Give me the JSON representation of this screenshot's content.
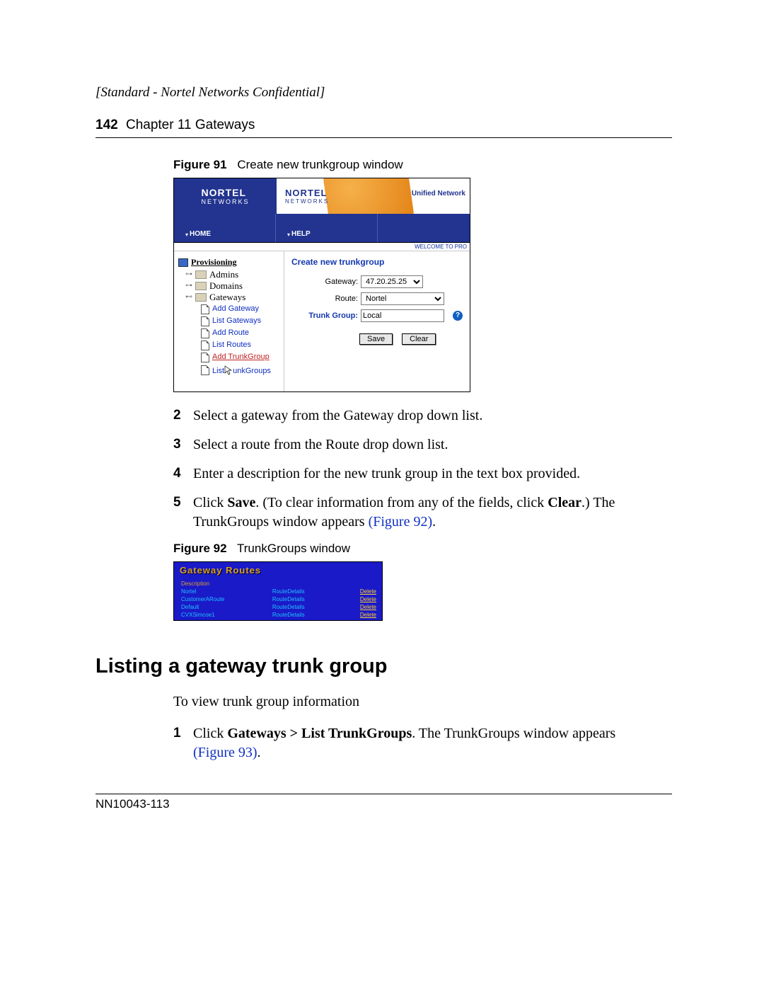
{
  "confidential": "[Standard - Nortel Networks Confidential]",
  "header": {
    "page": "142",
    "chapter": "Chapter 11  Gateways"
  },
  "fig91": {
    "caption_num": "Figure 91",
    "caption_text": "Create new trunkgroup window",
    "brand_big": "NORTEL",
    "brand_small": "NETWORKS",
    "unified": "Unified Network",
    "menu_home": "HOME",
    "menu_help": "HELP",
    "welcome": "WELCOME TO PRO",
    "nav": {
      "root": "Provisioning",
      "admins": "Admins",
      "domains": "Domains",
      "gateways": "Gateways",
      "add_gateway": "Add Gateway",
      "list_gateways": "List Gateways",
      "add_route": "Add Route",
      "list_routes": "List Routes",
      "add_trunkgroup": "Add TrunkGroup",
      "list_trunkgroups": "List TrunkGroups"
    },
    "form": {
      "title": "Create new trunkgroup",
      "gateway_label": "Gateway:",
      "gateway_value": "47.20.25.25",
      "route_label": "Route:",
      "route_value": "Nortel",
      "trunkgroup_label": "Trunk Group:",
      "trunkgroup_value": "Local",
      "save": "Save",
      "clear": "Clear"
    }
  },
  "steps_a": {
    "s2": "Select a gateway from the Gateway drop down list.",
    "s3": "Select a route from the Route drop down list.",
    "s4": "Enter a description for the new trunk group in the text box provided.",
    "s5_a": "Click ",
    "s5_b": "Save",
    "s5_c": ". (To clear information from any of the fields, click ",
    "s5_d": "Clear",
    "s5_e": ".) The TrunkGroups window appears ",
    "s5_ref": "(Figure 92)",
    "s5_f": "."
  },
  "fig92": {
    "caption_num": "Figure 92",
    "caption_text": "TrunkGroups window",
    "title": "Gateway Routes",
    "rows": [
      {
        "c1": "Description",
        "c2": "",
        "c3": ""
      },
      {
        "c1": "Nortel",
        "c2": "RouteDetails",
        "c3": "Delete"
      },
      {
        "c1": "CustomerARoute",
        "c2": "RouteDetails",
        "c3": "Delete"
      },
      {
        "c1": "Default",
        "c2": "RouteDetails",
        "c3": "Delete"
      },
      {
        "c1": "CVXSimcoe1",
        "c2": "RouteDetails",
        "c3": "Delete"
      }
    ]
  },
  "section_heading": "Listing a gateway trunk group",
  "section_intro": "To view trunk group information",
  "steps_b": {
    "s1_a": "Click ",
    "s1_b": "Gateways > List TrunkGroups",
    "s1_c": ". The TrunkGroups window appears ",
    "s1_ref": "(Figure 93)",
    "s1_d": "."
  },
  "footer": "NN10043-113"
}
